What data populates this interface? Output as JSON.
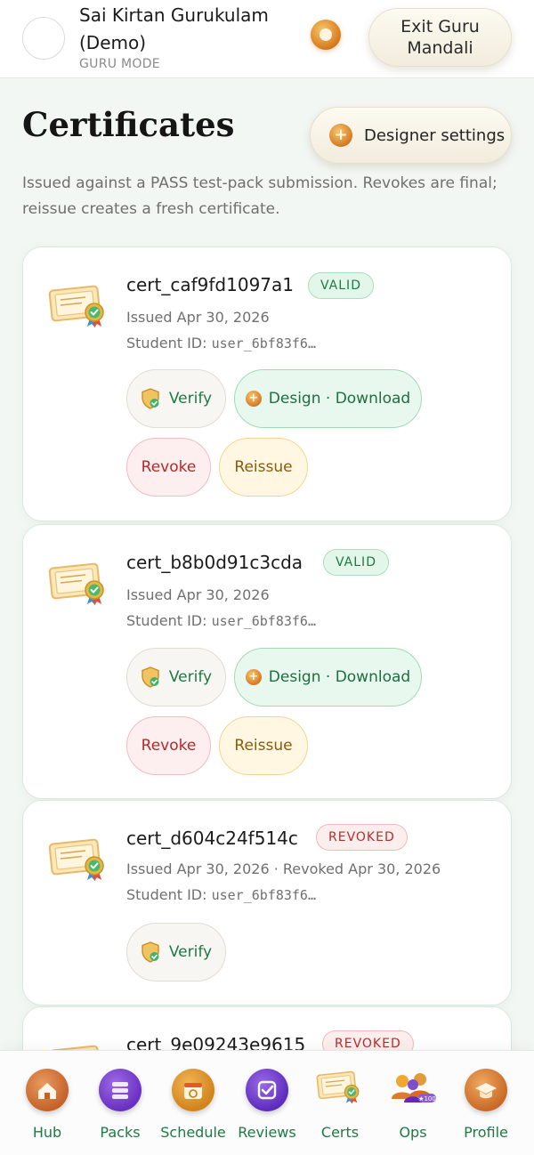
{
  "header": {
    "org_name": "Sai Kirtan Gurukulam (Demo)",
    "mode": "GURU MODE",
    "exit_label": "Exit Guru Mandali",
    "badge_icon": "coin-badge-icon"
  },
  "page": {
    "title": "Certificates",
    "designer_label": "Designer settings",
    "subtitle": "Issued against a PASS test-pack submission. Revokes are final; reissue creates a fresh certificate."
  },
  "certificates": [
    {
      "id": "cert_caf9fd1097a1",
      "status": "VALID",
      "issued": "Issued Apr 30, 2026",
      "student_prefix": "Student ID: ",
      "student_id": "user_6bf83f6…",
      "actions": {
        "verify": "Verify",
        "design": "Design · Download",
        "revoke": "Revoke",
        "reissue": "Reissue"
      }
    },
    {
      "id": "cert_b8b0d91c3cda",
      "status": "VALID",
      "issued": "Issued Apr 30, 2026",
      "student_prefix": "Student ID: ",
      "student_id": "user_6bf83f6…",
      "actions": {
        "verify": "Verify",
        "design": "Design · Download",
        "revoke": "Revoke",
        "reissue": "Reissue"
      }
    },
    {
      "id": "cert_d604c24f514c",
      "status": "REVOKED",
      "issued": "Issued Apr 30, 2026 · Revoked Apr 30, 2026",
      "student_prefix": "Student ID: ",
      "student_id": "user_6bf83f6…",
      "actions": {
        "verify": "Verify"
      }
    },
    {
      "id": "cert_9e09243e9615",
      "status": "REVOKED"
    }
  ],
  "nav": [
    {
      "label": "Hub",
      "icon": "home-icon",
      "color": "#c9682d"
    },
    {
      "label": "Packs",
      "icon": "stack-icon",
      "color": "#7b3fd0"
    },
    {
      "label": "Schedule",
      "icon": "calendar-icon",
      "color": "#d88a1f"
    },
    {
      "label": "Reviews",
      "icon": "checkbox-icon",
      "color": "#6a36c8"
    },
    {
      "label": "Certs",
      "icon": "certificate-icon",
      "color": "#e8c46a"
    },
    {
      "label": "Ops",
      "icon": "team-icon",
      "color": "#e0922a"
    },
    {
      "label": "Profile",
      "icon": "graduation-cap-icon",
      "color": "#d0782a"
    }
  ],
  "colors": {
    "accent_green": "#1d7a45",
    "revoke_red": "#b52a2a",
    "reissue_amber": "#8b5a0b"
  }
}
